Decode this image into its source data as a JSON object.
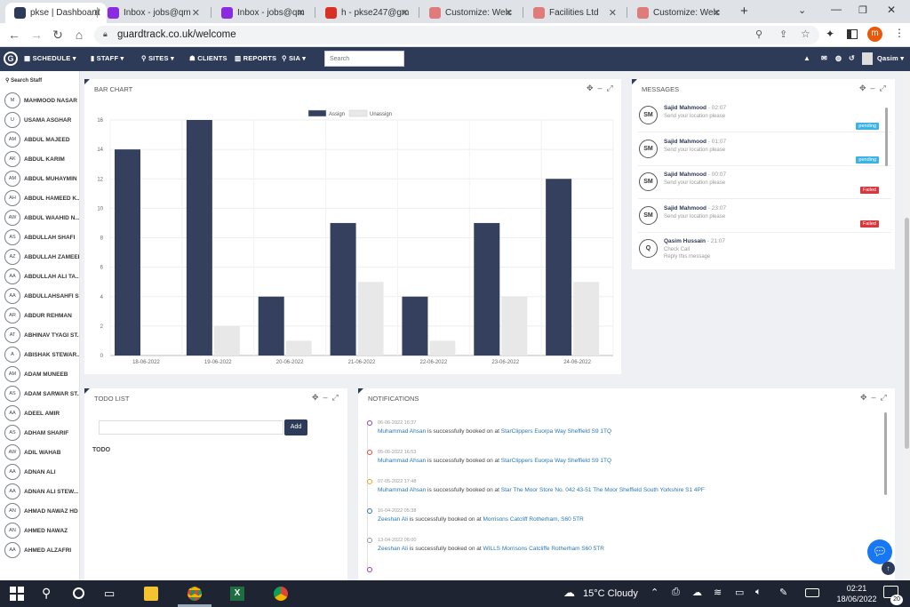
{
  "browser": {
    "tabs": [
      {
        "label": "pkse | Dashboard",
        "color": "#2d3a58"
      },
      {
        "label": "Inbox - jobs@qm",
        "color": "#8a2be2"
      },
      {
        "label": "Inbox - jobs@qm",
        "color": "#8a2be2"
      },
      {
        "label": "h - pkse247@gm",
        "color": "#d93025"
      },
      {
        "label": "Customize: Welc",
        "color": "#e07b7b"
      },
      {
        "label": "Facilities Ltd",
        "color": "#e07b7b"
      },
      {
        "label": "Customize: Welc",
        "color": "#e07b7b"
      }
    ],
    "url": "guardtrack.co.uk/welcome",
    "profile_initial": "m"
  },
  "nav": {
    "schedule": "SCHEDULE",
    "staff": "STAFF",
    "sites": "SITES",
    "clients": "CLIENTS",
    "reports": "REPORTS",
    "sia": "SIA",
    "search_placeholder": "Search",
    "user": "Qasim"
  },
  "sidebar": {
    "search_label": "Search Staff",
    "staff": [
      {
        "initials": "M",
        "name": "MAHMOOD NASAR"
      },
      {
        "initials": "U",
        "name": "USAMA ASGHAR"
      },
      {
        "initials": "AM",
        "name": "ABDUL MAJEED"
      },
      {
        "initials": "AK",
        "name": "ABDUL KARIM"
      },
      {
        "initials": "AM",
        "name": "ABDUL MUHAYMIN"
      },
      {
        "initials": "AH",
        "name": "ABDUL HAMEED K..."
      },
      {
        "initials": "AW",
        "name": "ABDUL WAAHID N..."
      },
      {
        "initials": "AS",
        "name": "ABDULLAH SHAFI"
      },
      {
        "initials": "AZ",
        "name": "ABDULLAH ZAMEER"
      },
      {
        "initials": "AA",
        "name": "ABDULLAH ALI TA..."
      },
      {
        "initials": "AA",
        "name": "ABDULLAHSAHFI S..."
      },
      {
        "initials": "AR",
        "name": "ABDUR REHMAN"
      },
      {
        "initials": "AT",
        "name": "ABHINAV TYAGI ST..."
      },
      {
        "initials": "A",
        "name": "ABISHAK STEWAR..."
      },
      {
        "initials": "AM",
        "name": "ADAM MUNEEB"
      },
      {
        "initials": "AS",
        "name": "ADAM SARWAR ST..."
      },
      {
        "initials": "AA",
        "name": "ADEEL AMIR"
      },
      {
        "initials": "AS",
        "name": "ADHAM SHARIF"
      },
      {
        "initials": "AW",
        "name": "ADIL WAHAB"
      },
      {
        "initials": "AA",
        "name": "ADNAN ALI"
      },
      {
        "initials": "AA",
        "name": "ADNAN ALI STEW..."
      },
      {
        "initials": "AN",
        "name": "AHMAD NAWAZ HD"
      },
      {
        "initials": "AN",
        "name": "AHMED NAWAZ"
      },
      {
        "initials": "AA",
        "name": "AHMED ALZAFRI"
      }
    ]
  },
  "bar_panel": {
    "title": "BAR CHART"
  },
  "chart_data": {
    "type": "bar",
    "categories": [
      "18-06-2022",
      "19-06-2022",
      "20-06-2022",
      "21-06-2022",
      "22-06-2022",
      "23-06-2022",
      "24-06-2022"
    ],
    "series": [
      {
        "name": "Assign",
        "color": "#34405e",
        "values": [
          14,
          16,
          4,
          9,
          4,
          9,
          12
        ]
      },
      {
        "name": "Unassign",
        "color": "#e8e8e8",
        "values": [
          0,
          2,
          1,
          5,
          1,
          4,
          5
        ]
      }
    ],
    "ylim": [
      0,
      16
    ],
    "yticks": [
      "0",
      "2",
      "4",
      "6",
      "8",
      "10",
      "12",
      "14",
      "16"
    ],
    "legend": "top",
    "grid": true
  },
  "messages": {
    "title": "MESSAGES",
    "items": [
      {
        "initials": "SM",
        "name": "Sajid Mahmood",
        "time": " - 02:07",
        "text": "Send your location please",
        "badge": "pending",
        "badge_color": "#3bb4e5"
      },
      {
        "initials": "SM",
        "name": "Sajid Mahmood",
        "time": " - 01:07",
        "text": "Send your location please",
        "badge": "pending",
        "badge_color": "#3bb4e5"
      },
      {
        "initials": "SM",
        "name": "Sajid Mahmood",
        "time": " - 00:07",
        "text": "Send your location please",
        "badge": "Failed",
        "badge_color": "#d9363e"
      },
      {
        "initials": "SM",
        "name": "Sajid Mahmood",
        "time": " - 23:07",
        "text": "Send your location please",
        "badge": "Failed",
        "badge_color": "#d9363e"
      },
      {
        "initials": "Q",
        "name": "Qasim Hussain",
        "time": " - 21:07",
        "text": "Check Call",
        "text2": "Reply this message",
        "badge": "",
        "badge_color": ""
      }
    ]
  },
  "todo": {
    "title": "TODO LIST",
    "add_label": "Add",
    "input_value": "",
    "heading": "TODO"
  },
  "notifications": {
    "title": "NOTIFICATIONS",
    "items": [
      {
        "date": "06-06-2022 16:37",
        "person": "Muhammad Ahsan",
        "middle": " is successfully booked on at ",
        "place": "StarClippers Euorpa Way Sheffield S9 1TQ",
        "color": "#8e44ad"
      },
      {
        "date": "05-06-2022 16:53",
        "person": "Muhammad Ahsan",
        "middle": " is successfully booked on at ",
        "place": "StarClippers Euorpa Way Sheffield S9 1TQ",
        "color": "#e74c3c"
      },
      {
        "date": "07-05-2022 17:48",
        "person": "Muhammad Ahsan",
        "middle": " is successfully booked on at ",
        "place": "Star The Moor Store No. 042 43-51 The Moor Sheffield South Yorkshire S1 4PF",
        "color": "#f1a32c"
      },
      {
        "date": "16-04-2022 05:38",
        "person": "Zeeshan Ali",
        "middle": " is successfully booked on at ",
        "place": "Morrisons Catcliff Rotherham, S60 5TR",
        "color": "#2a78b8"
      },
      {
        "date": "13-04-2022 06:00",
        "person": "Zeeshan Ali",
        "middle": " is successfully booked on at ",
        "place": "WILLS Morrisons Catcliffe Rotherham S60 5TR",
        "color": "#999999"
      }
    ]
  },
  "taskbar": {
    "weather": "15°C  Cloudy",
    "time": "02:21",
    "date": "18/06/2022",
    "notifications": "20"
  }
}
